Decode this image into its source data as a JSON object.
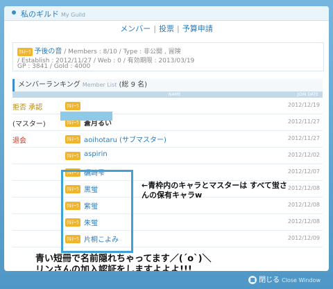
{
  "title": {
    "main": "私のギルド",
    "sub": "My Guild"
  },
  "nav": [
    "メンバー",
    "投票",
    "予算申請"
  ],
  "guild": {
    "badge": "ｸﾙﾃｰﾗ",
    "name": "予後の音",
    "line1": "/ Members : 8/10 / Type : 非公開 , 冒険",
    "line2": "/ Establish : 2012/11/27 / Web : 0 / 有効期限 : 2013/03/19",
    "line3": "GP : 3841 / Gold : 4000"
  },
  "ranking": {
    "title": "メンバーランキング",
    "sub": "Member List",
    "count": "(総 9 名)",
    "col_name": "NAME",
    "col_date": "JOIN DATE"
  },
  "rows": [
    {
      "action": "拒否 承認",
      "badge": "ｸﾙﾃｰﾗ",
      "name": "",
      "date": "2012/12/19"
    },
    {
      "action": "(マスター)",
      "badge": "ｸﾙﾃｰﾗ",
      "name": "蒼月るい",
      "date": "2012/11/27"
    },
    {
      "action": "退会",
      "badge": "ｸﾙﾃｰﾗ",
      "name": "aoihotaru (サブマスター)",
      "date": "2012/11/27"
    },
    {
      "action": "",
      "badge": "ｸﾙﾃｰﾗ",
      "name": "aspirin",
      "date": "2012/12/02"
    },
    {
      "action": "",
      "badge": "ｸﾙﾃｰﾗ",
      "name": "礪崎雫",
      "date": "2012/12/07"
    },
    {
      "action": "",
      "badge": "ｸﾙﾃｰﾗ",
      "name": "黒蛍",
      "date": "2012/12/08"
    },
    {
      "action": "",
      "badge": "ｸﾙﾃｰﾗ",
      "name": "紫蛍",
      "date": "2012/12/08"
    },
    {
      "action": "",
      "badge": "ｸﾙﾃｰﾗ",
      "name": "朱蛍",
      "date": "2012/12/08"
    },
    {
      "action": "",
      "badge": "ｸﾙﾃｰﾗ",
      "name": "片桐こよみ",
      "date": "2012/12/09"
    }
  ],
  "annotations": {
    "arrow_note": "←青枠内のキャラとマスターは すべて蛍さんの保有キャラw",
    "bottom_note_1": "青い短冊で名前隠れちゃってます／(´o`)＼",
    "bottom_note_2": "リンさんの加入認証をしますよよよ!!!"
  },
  "close": {
    "label": "閉じる",
    "sub": "Close Window"
  },
  "colors": {
    "accent": "#2b7ab8",
    "badge": "#f0b52a",
    "frame": "#5aa3d0"
  }
}
